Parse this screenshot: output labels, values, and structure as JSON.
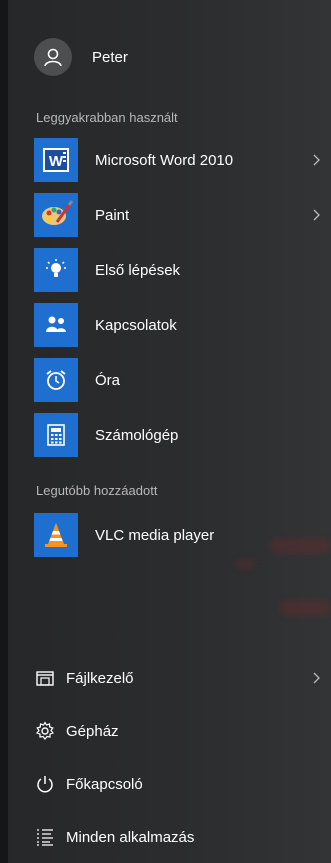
{
  "user": {
    "name": "Peter",
    "icon": "user-icon"
  },
  "sections": {
    "most_used": "Leggyakrabban használt",
    "recently_added": "Legutóbb hozzáadott"
  },
  "most_used": [
    {
      "label": "Microsoft Word 2010",
      "icon": "word-icon",
      "has_submenu": true
    },
    {
      "label": "Paint",
      "icon": "paint-icon",
      "has_submenu": true
    },
    {
      "label": "Első lépések",
      "icon": "lightbulb-icon",
      "has_submenu": false
    },
    {
      "label": "Kapcsolatok",
      "icon": "people-icon",
      "has_submenu": false
    },
    {
      "label": "Óra",
      "icon": "alarm-clock-icon",
      "has_submenu": false
    },
    {
      "label": "Számológép",
      "icon": "calculator-icon",
      "has_submenu": false
    }
  ],
  "recently_added": [
    {
      "label": "VLC media player",
      "icon": "vlc-cone-icon",
      "has_submenu": false
    }
  ],
  "bottom": [
    {
      "label": "Fájlkezelő",
      "icon": "file-explorer-icon",
      "has_submenu": true
    },
    {
      "label": "Gépház",
      "icon": "gear-icon",
      "has_submenu": false
    },
    {
      "label": "Főkapcsoló",
      "icon": "power-icon",
      "has_submenu": false
    },
    {
      "label": "Minden alkalmazás",
      "icon": "all-apps-list-icon",
      "has_submenu": false
    }
  ],
  "colors": {
    "tile": "#1f6fd1",
    "background": "#2a2b2c",
    "section_text": "#b8b8b8"
  }
}
